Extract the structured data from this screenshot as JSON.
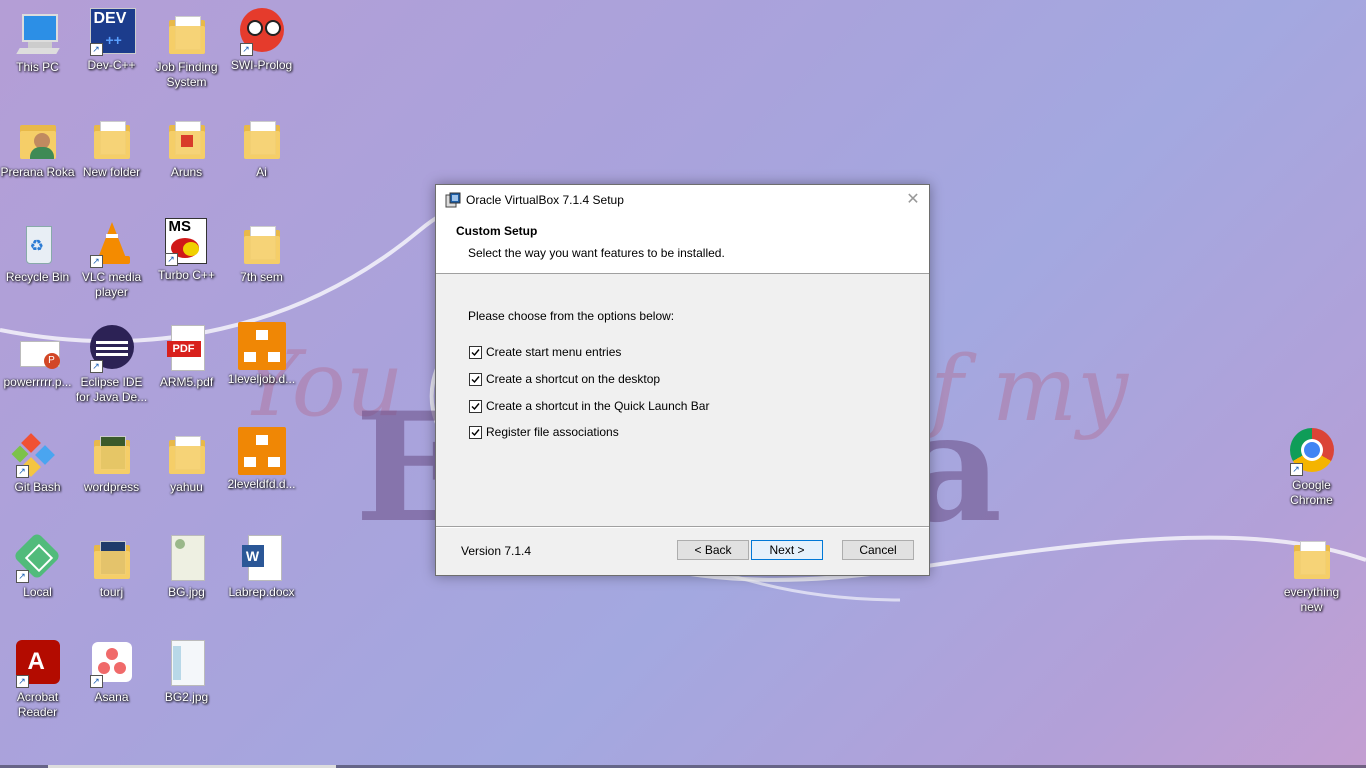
{
  "desktop": {
    "icons": [
      {
        "label": "This PC",
        "icon": "computer-icon"
      },
      {
        "label": "Dev-C++",
        "icon": "devcpp-icon",
        "glyph_text": "DEV"
      },
      {
        "label": "Job Finding System",
        "icon": "folder-icon"
      },
      {
        "label": "SWI-Prolog",
        "icon": "owl-icon"
      },
      {
        "label": "Prerana Roka",
        "icon": "user-folder-icon"
      },
      {
        "label": "New folder",
        "icon": "folder-icon"
      },
      {
        "label": "Aruns",
        "icon": "folder-icon"
      },
      {
        "label": "Ai",
        "icon": "folder-icon"
      },
      {
        "label": "Recycle Bin",
        "icon": "recycle-bin-icon"
      },
      {
        "label": "VLC media player",
        "icon": "vlc-cone-icon"
      },
      {
        "label": "Turbo C++",
        "icon": "turbo-cpp-icon",
        "glyph_text": "MS"
      },
      {
        "label": "7th sem",
        "icon": "folder-icon"
      },
      {
        "label": "powerrrrr.p...",
        "icon": "powerpoint-file-icon"
      },
      {
        "label": "Eclipse IDE for Java De...",
        "icon": "eclipse-icon"
      },
      {
        "label": "ARM5.pdf",
        "icon": "pdf-file-icon",
        "glyph_text": "PDF"
      },
      {
        "label": "1leveljob.d...",
        "icon": "drawio-icon"
      },
      {
        "label": "Git Bash",
        "icon": "git-icon"
      },
      {
        "label": "wordpress",
        "icon": "folder-icon"
      },
      {
        "label": "yahuu",
        "icon": "folder-icon"
      },
      {
        "label": "2leveldfd.d...",
        "icon": "drawio-icon"
      },
      {
        "label": "Local",
        "icon": "local-icon"
      },
      {
        "label": "tourj",
        "icon": "folder-icon"
      },
      {
        "label": "BG.jpg",
        "icon": "image-file-icon"
      },
      {
        "label": "Labrep.docx",
        "icon": "word-file-icon",
        "glyph_text": "W"
      },
      {
        "label": "Acrobat Reader",
        "icon": "acrobat-icon"
      },
      {
        "label": "Asana",
        "icon": "asana-icon"
      },
      {
        "label": "BG2.jpg",
        "icon": "image-file-icon"
      },
      {
        "label": "Google Chrome",
        "icon": "chrome-icon"
      },
      {
        "label": "everything new",
        "icon": "folder-icon"
      }
    ],
    "wallpaper": {
      "script_text": "You a",
      "script_text_2": "f my",
      "big_text_left": "E",
      "big_text_right": "a"
    }
  },
  "dialog": {
    "title": "Oracle VirtualBox 7.1.4 Setup",
    "close_glyph": "✕",
    "header_title": "Custom Setup",
    "header_subtitle": "Select the way you want features to be installed.",
    "prompt": "Please choose from the options below:",
    "options": [
      {
        "label": "Create start menu entries",
        "checked": true
      },
      {
        "label": "Create a shortcut on the desktop",
        "checked": true
      },
      {
        "label": "Create a shortcut in the Quick Launch Bar",
        "checked": true
      },
      {
        "label": "Register file associations",
        "checked": true
      }
    ],
    "version": "Version 7.1.4",
    "buttons": {
      "back": "< Back",
      "next": "Next >",
      "cancel": "Cancel"
    }
  },
  "colors": {
    "accent": "#0078d7",
    "folder": "#f5cf6b"
  }
}
